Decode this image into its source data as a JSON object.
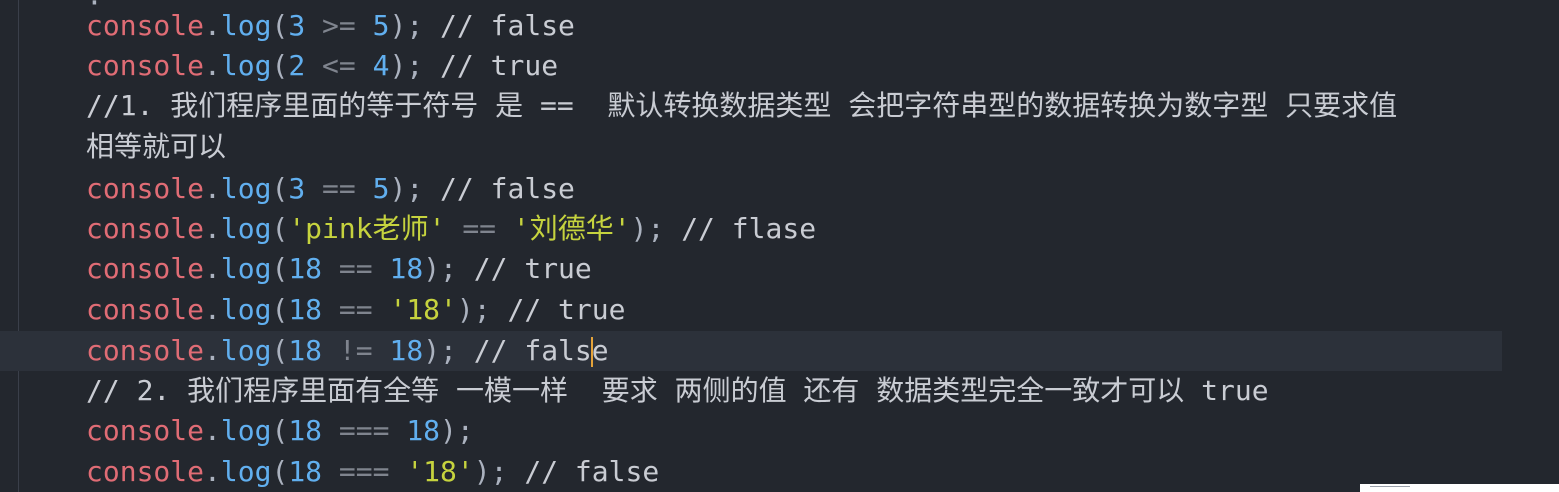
{
  "editor": {
    "lines": [
      {
        "tokens": [
          {
            "t": "obj",
            "v": "console"
          },
          {
            "t": "punc",
            "v": "."
          },
          {
            "t": "fn",
            "v": "log"
          },
          {
            "t": "punc",
            "v": "("
          },
          {
            "t": "num",
            "v": "3"
          },
          {
            "t": "punc",
            "v": " "
          },
          {
            "t": "op",
            "v": ">="
          },
          {
            "t": "punc",
            "v": " "
          },
          {
            "t": "num",
            "v": "5"
          },
          {
            "t": "punc",
            "v": "); "
          },
          {
            "t": "cmt",
            "v": "// false"
          }
        ]
      },
      {
        "tokens": [
          {
            "t": "obj",
            "v": "console"
          },
          {
            "t": "punc",
            "v": "."
          },
          {
            "t": "fn",
            "v": "log"
          },
          {
            "t": "punc",
            "v": "("
          },
          {
            "t": "num",
            "v": "2"
          },
          {
            "t": "punc",
            "v": " "
          },
          {
            "t": "op",
            "v": "<="
          },
          {
            "t": "punc",
            "v": " "
          },
          {
            "t": "num",
            "v": "4"
          },
          {
            "t": "punc",
            "v": "); "
          },
          {
            "t": "cmt",
            "v": "// true"
          }
        ]
      },
      {
        "tokens": [
          {
            "t": "cmt-zh",
            "v": "//1. 我们程序里面的等于符号 是 ==  默认转换数据类型 会把字符串型的数据转换为数字型 只要求值"
          }
        ]
      },
      {
        "tokens": [
          {
            "t": "cmt-zh",
            "v": "相等就可以"
          }
        ]
      },
      {
        "tokens": [
          {
            "t": "obj",
            "v": "console"
          },
          {
            "t": "punc",
            "v": "."
          },
          {
            "t": "fn",
            "v": "log"
          },
          {
            "t": "punc",
            "v": "("
          },
          {
            "t": "num",
            "v": "3"
          },
          {
            "t": "punc",
            "v": " "
          },
          {
            "t": "op",
            "v": "=="
          },
          {
            "t": "punc",
            "v": " "
          },
          {
            "t": "num",
            "v": "5"
          },
          {
            "t": "punc",
            "v": "); "
          },
          {
            "t": "cmt",
            "v": "// false"
          }
        ]
      },
      {
        "tokens": [
          {
            "t": "obj",
            "v": "console"
          },
          {
            "t": "punc",
            "v": "."
          },
          {
            "t": "fn",
            "v": "log"
          },
          {
            "t": "punc",
            "v": "("
          },
          {
            "t": "str",
            "v": "'pink老师'"
          },
          {
            "t": "punc",
            "v": " "
          },
          {
            "t": "op",
            "v": "=="
          },
          {
            "t": "punc",
            "v": " "
          },
          {
            "t": "str",
            "v": "'刘德华'"
          },
          {
            "t": "punc",
            "v": "); "
          },
          {
            "t": "cmt",
            "v": "// flase"
          }
        ]
      },
      {
        "tokens": [
          {
            "t": "obj",
            "v": "console"
          },
          {
            "t": "punc",
            "v": "."
          },
          {
            "t": "fn",
            "v": "log"
          },
          {
            "t": "punc",
            "v": "("
          },
          {
            "t": "num",
            "v": "18"
          },
          {
            "t": "punc",
            "v": " "
          },
          {
            "t": "op",
            "v": "=="
          },
          {
            "t": "punc",
            "v": " "
          },
          {
            "t": "num",
            "v": "18"
          },
          {
            "t": "punc",
            "v": "); "
          },
          {
            "t": "cmt",
            "v": "// true"
          }
        ]
      },
      {
        "tokens": [
          {
            "t": "obj",
            "v": "console"
          },
          {
            "t": "punc",
            "v": "."
          },
          {
            "t": "fn",
            "v": "log"
          },
          {
            "t": "punc",
            "v": "("
          },
          {
            "t": "num",
            "v": "18"
          },
          {
            "t": "punc",
            "v": " "
          },
          {
            "t": "op",
            "v": "=="
          },
          {
            "t": "punc",
            "v": " "
          },
          {
            "t": "str",
            "v": "'18'"
          },
          {
            "t": "punc",
            "v": "); "
          },
          {
            "t": "cmt",
            "v": "// true"
          }
        ]
      },
      {
        "active": true,
        "tokens": [
          {
            "t": "obj",
            "v": "console"
          },
          {
            "t": "punc",
            "v": "."
          },
          {
            "t": "fn",
            "v": "log"
          },
          {
            "t": "punc",
            "v": "("
          },
          {
            "t": "num",
            "v": "18"
          },
          {
            "t": "punc",
            "v": " "
          },
          {
            "t": "op",
            "v": "!="
          },
          {
            "t": "punc",
            "v": " "
          },
          {
            "t": "num",
            "v": "18"
          },
          {
            "t": "punc",
            "v": "); "
          },
          {
            "t": "cmt",
            "v": "// fals"
          },
          {
            "t": "cursor",
            "v": ""
          },
          {
            "t": "cmt",
            "v": "e"
          }
        ]
      },
      {
        "tokens": [
          {
            "t": "cmt-zh",
            "v": "// 2. 我们程序里面有全等 一模一样  要求 两侧的值 还有 数据类型完全一致才可以 true"
          }
        ]
      },
      {
        "tokens": [
          {
            "t": "obj",
            "v": "console"
          },
          {
            "t": "punc",
            "v": "."
          },
          {
            "t": "fn",
            "v": "log"
          },
          {
            "t": "punc",
            "v": "("
          },
          {
            "t": "num",
            "v": "18"
          },
          {
            "t": "punc",
            "v": " "
          },
          {
            "t": "op",
            "v": "==="
          },
          {
            "t": "punc",
            "v": " "
          },
          {
            "t": "num",
            "v": "18"
          },
          {
            "t": "punc",
            "v": ");"
          }
        ]
      },
      {
        "tokens": [
          {
            "t": "obj",
            "v": "console"
          },
          {
            "t": "punc",
            "v": "."
          },
          {
            "t": "fn",
            "v": "log"
          },
          {
            "t": "punc",
            "v": "("
          },
          {
            "t": "num",
            "v": "18"
          },
          {
            "t": "punc",
            "v": " "
          },
          {
            "t": "op",
            "v": "==="
          },
          {
            "t": "punc",
            "v": " "
          },
          {
            "t": "str",
            "v": "'18'"
          },
          {
            "t": "punc",
            "v": "); "
          },
          {
            "t": "cmt",
            "v": "// false"
          }
        ]
      }
    ],
    "colors": {
      "background": "#23272e",
      "active_line": "#2c313a",
      "identifier": "#e06c75",
      "function": "#61afef",
      "number": "#61afef",
      "string": "#c6d33e",
      "operator": "#7f848e",
      "comment": "#c9ccd3",
      "cursor": "#e5a33a"
    }
  }
}
